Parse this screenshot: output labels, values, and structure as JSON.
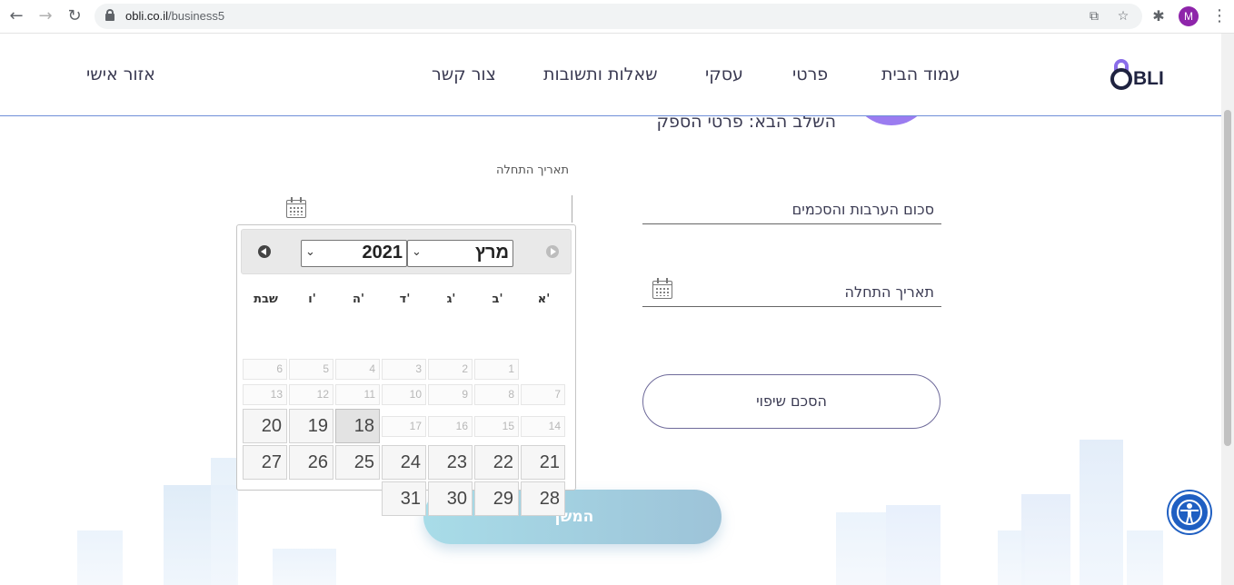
{
  "browser": {
    "url_host": "obli.co.il",
    "url_path": "/business5",
    "profile_initial": "M"
  },
  "header": {
    "logo_text": "BLI",
    "nav": {
      "home": "עמוד הבית",
      "private": "פרטי",
      "business": "עסקי",
      "faq": "שאלות ותשובות",
      "contact": "צור קשר",
      "personal_area": "אזור אישי"
    }
  },
  "step": {
    "next_step": "השלב הבא: פרטי הספק"
  },
  "form": {
    "start_date_label_small": "תאריך התחלה",
    "guarantee_amount": "סכום הערבות והסכמים",
    "start_date": "תאריך התחלה",
    "compensation_button": "הסכם שיפוי",
    "continue_button": "המשך"
  },
  "datepicker": {
    "month": "מרץ",
    "year": "2021",
    "weekdays": [
      "א'",
      "ב'",
      "ג'",
      "ד'",
      "ה'",
      "ו'",
      "שבת"
    ],
    "today": "18",
    "disabled_days": [
      "1",
      "2",
      "3",
      "4",
      "5",
      "6",
      "7",
      "8",
      "9",
      "10",
      "11",
      "12",
      "13",
      "14",
      "15",
      "16",
      "17"
    ],
    "active_days": [
      "18",
      "19",
      "20",
      "21",
      "22",
      "23",
      "24",
      "25",
      "26",
      "27",
      "28",
      "29",
      "30",
      "31"
    ]
  }
}
